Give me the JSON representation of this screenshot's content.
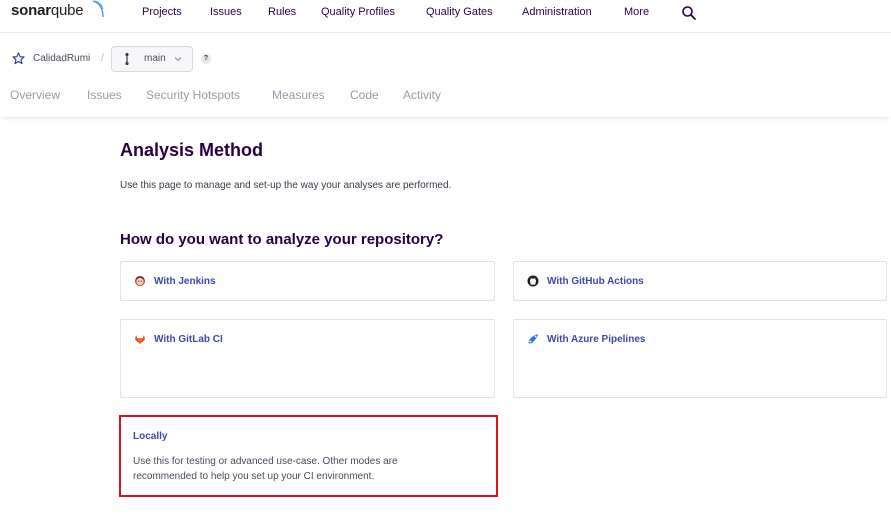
{
  "app": {
    "logo_text_bold": "sonar",
    "logo_text_light": "qube"
  },
  "nav": {
    "items": [
      "Projects",
      "Issues",
      "Rules",
      "Quality Profiles",
      "Quality Gates",
      "Administration",
      "More"
    ],
    "search_icon": "search-icon"
  },
  "project": {
    "name": "CalidadRumi",
    "separator": "/",
    "branch": "main",
    "help": "?",
    "tabs": [
      "Overview",
      "Issues",
      "Security Hotspots",
      "Measures",
      "Code",
      "Activity"
    ]
  },
  "page": {
    "title": "Analysis Method",
    "description": "Use this page to manage and set-up the way your analyses are performed.",
    "question": "How do you want to analyze your repository?"
  },
  "methods": [
    {
      "label": "With Jenkins",
      "icon": "jenkins-icon"
    },
    {
      "label": "With GitHub Actions",
      "icon": "github-icon"
    },
    {
      "label": "With GitLab CI",
      "icon": "gitlab-icon"
    },
    {
      "label": "With Azure Pipelines",
      "icon": "azure-pipelines-icon"
    }
  ],
  "locally": {
    "title": "Locally",
    "description": "Use this for testing or advanced use-case. Other modes are recommended to help you set up your CI environment."
  },
  "colors": {
    "accent": "#3b4aa8",
    "highlight_border": "#e0101a",
    "text_primary": "#290042"
  }
}
